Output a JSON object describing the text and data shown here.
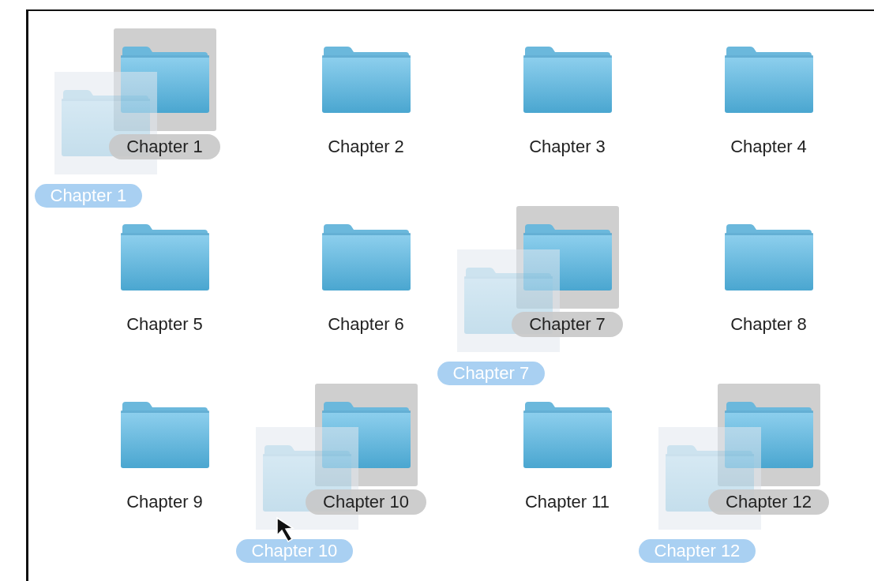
{
  "folders": [
    {
      "name": "Chapter 1",
      "selected": true,
      "drag_label": "Chapter 1",
      "pointer": false
    },
    {
      "name": "Chapter 2",
      "selected": false,
      "pointer": false
    },
    {
      "name": "Chapter 3",
      "selected": false,
      "pointer": false
    },
    {
      "name": "Chapter 4",
      "selected": false,
      "pointer": false
    },
    {
      "name": "Chapter 5",
      "selected": false,
      "pointer": false
    },
    {
      "name": "Chapter 6",
      "selected": false,
      "pointer": false
    },
    {
      "name": "Chapter 7",
      "selected": true,
      "drag_label": "Chapter 7",
      "pointer": false
    },
    {
      "name": "Chapter 8",
      "selected": false,
      "pointer": false
    },
    {
      "name": "Chapter 9",
      "selected": false,
      "pointer": false
    },
    {
      "name": "Chapter 10",
      "selected": true,
      "drag_label": "Chapter 10",
      "pointer": true
    },
    {
      "name": "Chapter 11",
      "selected": false,
      "pointer": false
    },
    {
      "name": "Chapter 12",
      "selected": true,
      "drag_label": "Chapter 12",
      "pointer": false
    }
  ]
}
